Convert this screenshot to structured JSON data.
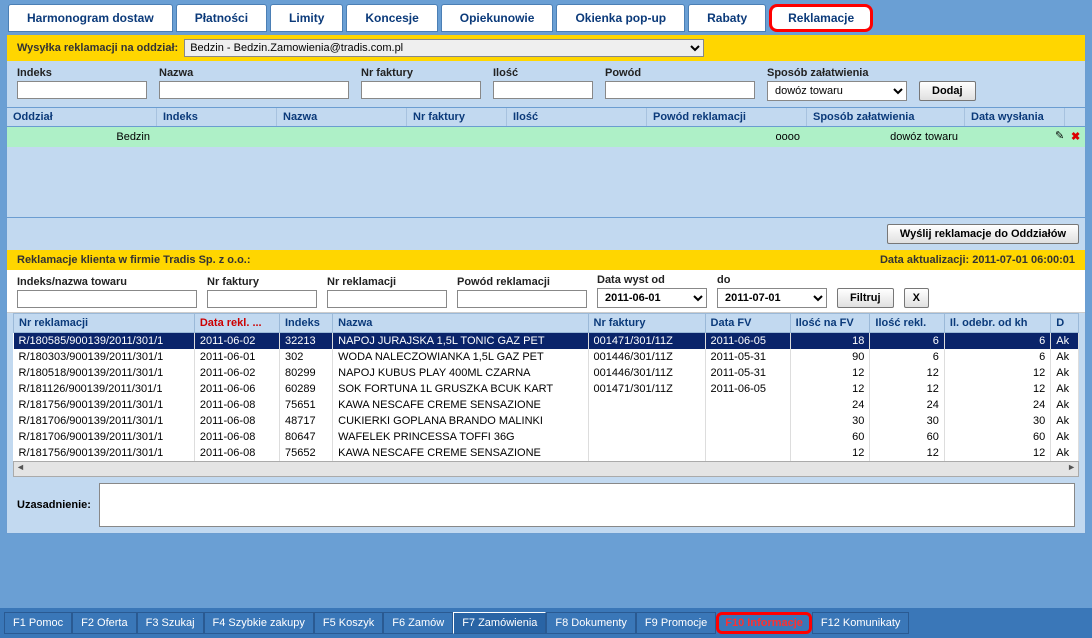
{
  "tabs": [
    "Harmonogram dostaw",
    "Płatności",
    "Limity",
    "Koncesje",
    "Opiekunowie",
    "Okienka pop-up",
    "Rabaty",
    "Reklamacje"
  ],
  "activeTab": 7,
  "send": {
    "label": "Wysyłka reklamacji na oddział:",
    "branch": "Bedzin  -  Bedzin.Zamowienia@tradis.com.pl"
  },
  "filters1": {
    "indeks": "Indeks",
    "nazwa": "Nazwa",
    "nrfak": "Nr faktury",
    "ilosc": "Ilość",
    "powod": "Powód",
    "sposob": "Sposób załatwienia",
    "sposob_val": "dowóz towaru",
    "dodaj": "Dodaj"
  },
  "cols1": [
    "Oddział",
    "Indeks",
    "Nazwa",
    "Nr faktury",
    "Ilość",
    "Powód reklamacji",
    "Sposób załatwienia",
    "Data wysłania"
  ],
  "row1": {
    "oddzial": "Bedzin",
    "powod": "oooo",
    "sposob": "dowóz towaru"
  },
  "sendBtn": "Wyślij reklamacje do Oddziałów",
  "bar2": {
    "left": "Reklamacje klienta w firmie Tradis Sp. z o.o.:",
    "right": "Data aktualizacji: 2011-07-01 06:00:01"
  },
  "filters2": {
    "inl": "Indeks/nazwa towaru",
    "nrfak": "Nr faktury",
    "nrrek": "Nr reklamacji",
    "powod": "Powód reklamacji",
    "dod": "Data wyst od",
    "dod_v": "2011-06-01",
    "do": "do",
    "do_v": "2011-07-01",
    "filtruj": "Filtruj",
    "x": "X"
  },
  "gridCols": [
    "Nr reklamacji",
    "Data rekl. ...",
    "Indeks",
    "Nazwa",
    "Nr faktury",
    "Data FV",
    "Ilość na FV",
    "Ilość rekl.",
    "Il. odebr. od kh",
    "D"
  ],
  "gridRows": [
    {
      "nr": "R/180585/900139/2011/301/1",
      "dr": "2011-06-02",
      "idx": "32213",
      "naz": "NAPOJ JURAJSKA 1,5L TONIC GAZ PET",
      "nf": "001471/301/11Z",
      "dfv": "2011-06-05",
      "ifv": "18",
      "ir": "6",
      "io": "6",
      "d": "Ak",
      "sel": true
    },
    {
      "nr": "R/180303/900139/2011/301/1",
      "dr": "2011-06-01",
      "idx": "302",
      "naz": "WODA NALECZOWIANKA 1,5L GAZ PET",
      "nf": "001446/301/11Z",
      "dfv": "2011-05-31",
      "ifv": "90",
      "ir": "6",
      "io": "6",
      "d": "Ak"
    },
    {
      "nr": "R/180518/900139/2011/301/1",
      "dr": "2011-06-02",
      "idx": "80299",
      "naz": "NAPOJ KUBUS PLAY 400ML CZARNA",
      "nf": "001446/301/11Z",
      "dfv": "2011-05-31",
      "ifv": "12",
      "ir": "12",
      "io": "12",
      "d": "Ak"
    },
    {
      "nr": "R/181126/900139/2011/301/1",
      "dr": "2011-06-06",
      "idx": "60289",
      "naz": "SOK FORTUNA 1L GRUSZKA BCUK KART",
      "nf": "001471/301/11Z",
      "dfv": "2011-06-05",
      "ifv": "12",
      "ir": "12",
      "io": "12",
      "d": "Ak"
    },
    {
      "nr": "R/181756/900139/2011/301/1",
      "dr": "2011-06-08",
      "idx": "75651",
      "naz": "KAWA NESCAFE CREME SENSAZIONE",
      "nf": "",
      "dfv": "",
      "ifv": "24",
      "ir": "24",
      "io": "24",
      "d": "Ak"
    },
    {
      "nr": "R/181706/900139/2011/301/1",
      "dr": "2011-06-08",
      "idx": "48717",
      "naz": "CUKIERKI GOPLANA BRANDO MALINKI",
      "nf": "",
      "dfv": "",
      "ifv": "30",
      "ir": "30",
      "io": "30",
      "d": "Ak"
    },
    {
      "nr": "R/181706/900139/2011/301/1",
      "dr": "2011-06-08",
      "idx": "80647",
      "naz": "WAFELEK PRINCESSA TOFFI 36G",
      "nf": "",
      "dfv": "",
      "ifv": "60",
      "ir": "60",
      "io": "60",
      "d": "Ak"
    },
    {
      "nr": "R/181756/900139/2011/301/1",
      "dr": "2011-06-08",
      "idx": "75652",
      "naz": "KAWA NESCAFE CREME SENSAZIONE",
      "nf": "",
      "dfv": "",
      "ifv": "12",
      "ir": "12",
      "io": "12",
      "d": "Ak"
    }
  ],
  "uz": "Uzasadnienie:",
  "fkeys": [
    "F1 Pomoc",
    "F2 Oferta",
    "F3 Szukaj",
    "F4 Szybkie zakupy",
    "F5 Koszyk",
    "F6 Zamów",
    "F7 Zamówienia",
    "F8 Dokumenty",
    "F9 Promocje",
    "F10 Informacje",
    "F12 Komunikaty"
  ]
}
